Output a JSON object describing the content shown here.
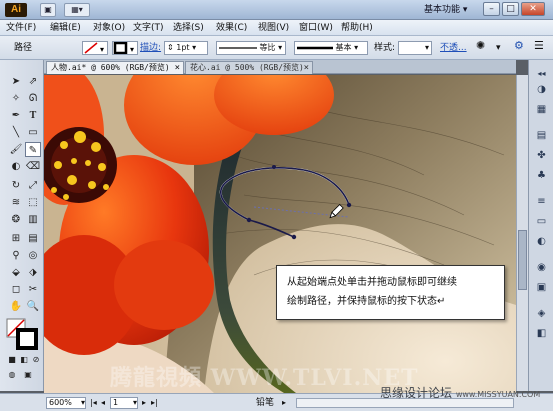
{
  "titlebar": {
    "logo": "Ai",
    "workspace": "基本功能",
    "workspace_arrow": "▾",
    "win_min": "–",
    "win_max": "□",
    "win_close": "✕"
  },
  "menu": [
    "文件(F)",
    "编辑(E)",
    "对象(O)",
    "文字(T)",
    "选择(S)",
    "效果(C)",
    "视图(V)",
    "窗口(W)",
    "帮助(H)"
  ],
  "control": {
    "path_label": "路径",
    "stroke_label": "描边:",
    "stroke_value": "1pt",
    "profile_label": "等比",
    "brush_label": "基本",
    "style_label": "样式:",
    "opacity_label": "不透..."
  },
  "tabs": [
    {
      "label": "人物.ai* @ 600% (RGB/预览)",
      "close": "×"
    },
    {
      "label": "花心.ai @ 500% (RGB/预览)",
      "close": "×"
    }
  ],
  "canvas": {
    "callout_line1": "从起始端点处单击并拖动鼠标即可继续",
    "callout_line2": "绘制路径，并保持鼠标的按下状态↵"
  },
  "statusbar": {
    "zoom": "600%",
    "page": "1",
    "tool": "铅笔"
  },
  "watermarks": {
    "center": "腾龍視頻 WWW.TLVI.NET",
    "right": "思缘设计论坛",
    "right_url": "www.MISSYUAN.COM"
  },
  "colors": {
    "flower": "#e8300c",
    "flower_light": "#ff6a1e",
    "hair": "#6b5a40",
    "path": "#1a1a4a"
  }
}
